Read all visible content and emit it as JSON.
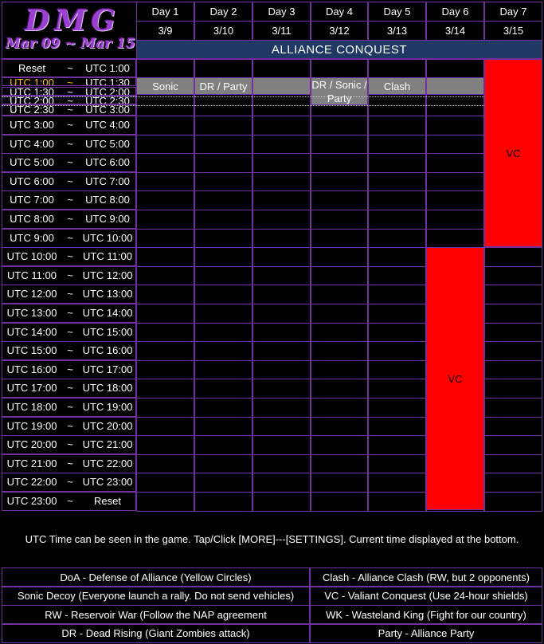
{
  "logo": {
    "name": "DMG",
    "dates": "Mar 09 ~ Mar 15"
  },
  "days": [
    {
      "label": "Day 1",
      "date": "3/9"
    },
    {
      "label": "Day 2",
      "date": "3/10"
    },
    {
      "label": "Day 3",
      "date": "3/11"
    },
    {
      "label": "Day 4",
      "date": "3/12"
    },
    {
      "label": "Day 5",
      "date": "3/13"
    },
    {
      "label": "Day 6",
      "date": "3/14"
    },
    {
      "label": "Day 7",
      "date": "3/15"
    }
  ],
  "title": "ALLIANCE CONQUEST",
  "tilde": "~",
  "time_rows": [
    {
      "start": "Reset",
      "end": "UTC 1:00"
    },
    {
      "start": "UTC 1:00",
      "end": "UTC 1:30"
    },
    {
      "start": "UTC 1:30",
      "end": "UTC 2:00"
    },
    {
      "start": "UTC 2:00",
      "end": "UTC 2:30"
    },
    {
      "start": "UTC 2:30",
      "end": "UTC 3:00"
    },
    {
      "start": "UTC 3:00",
      "end": "UTC 4:00"
    },
    {
      "start": "UTC 4:00",
      "end": "UTC 5:00"
    },
    {
      "start": "UTC 5:00",
      "end": "UTC 6:00"
    },
    {
      "start": "UTC 6:00",
      "end": "UTC 7:00"
    },
    {
      "start": "UTC 7:00",
      "end": "UTC 8:00"
    },
    {
      "start": "UTC 8:00",
      "end": "UTC 9:00"
    },
    {
      "start": "UTC 9:00",
      "end": "UTC 10:00"
    },
    {
      "start": "UTC 10:00",
      "end": "UTC 11:00"
    },
    {
      "start": "UTC 11:00",
      "end": "UTC 12:00"
    },
    {
      "start": "UTC 12:00",
      "end": "UTC 13:00"
    },
    {
      "start": "UTC 13:00",
      "end": "UTC 14:00"
    },
    {
      "start": "UTC 14:00",
      "end": "UTC 15:00"
    },
    {
      "start": "UTC 15:00",
      "end": "UTC 16:00"
    },
    {
      "start": "UTC 16:00",
      "end": "UTC 17:00"
    },
    {
      "start": "UTC 17:00",
      "end": "UTC 18:00"
    },
    {
      "start": "UTC 18:00",
      "end": "UTC 19:00"
    },
    {
      "start": "UTC 19:00",
      "end": "UTC 20:00"
    },
    {
      "start": "UTC 20:00",
      "end": "UTC 21:00"
    },
    {
      "start": "UTC 21:00",
      "end": "UTC 22:00"
    },
    {
      "start": "UTC 22:00",
      "end": "UTC 23:00"
    },
    {
      "start": "UTC 23:00",
      "end": "Reset"
    }
  ],
  "events": {
    "day1": "Sonic",
    "day2": "DR / Party",
    "day4": "DR / Sonic / Party",
    "day5": "Clash",
    "day6": "VC",
    "day7": "VC"
  },
  "note": "UTC Time can be seen in the game. Tap/Click [MORE]---[SETTINGS]. Current time displayed at the bottom.",
  "legend": {
    "left": [
      "DoA - Defense of Alliance (Yellow Circles)",
      "Sonic Decoy (Everyone launch a rally. Do not send vehicles)",
      "RW - Reservoir War (Follow the NAP agreement",
      "DR - Dead Rising (Giant Zombies attack)"
    ],
    "right": [
      "Clash - Alliance Clash (RW, but 2 opponents)",
      "VC - Valiant Conquest (Use 24-hour shields)",
      "WK - Wasteland King (Fight for our country)",
      "Party - Alliance Party"
    ]
  },
  "colors": {
    "border": "#7030a0",
    "title_bg": "#1f3864",
    "event_gray": "#808080",
    "vc_red": "#ff0000",
    "current_time": "#ffc000"
  }
}
